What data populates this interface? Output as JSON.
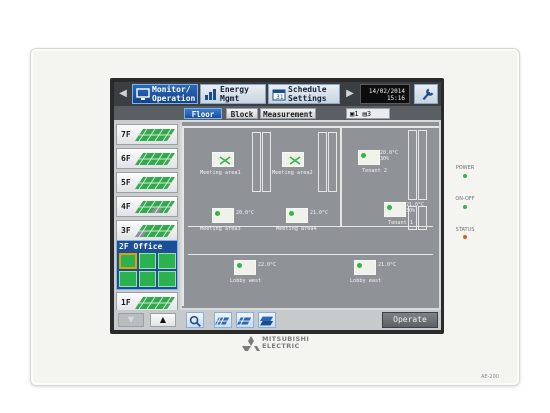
{
  "nav": {
    "tabs": [
      {
        "label": "Monitor/\nOperation",
        "icon": "monitor-icon",
        "active": true
      },
      {
        "label": "Energy\nMgmt",
        "icon": "energy-bars-icon",
        "active": false
      },
      {
        "label": "Schedule\nSettings",
        "icon": "calendar-icon",
        "active": false
      }
    ],
    "datetime": "14/02/2014\n15:16"
  },
  "subtabs": [
    {
      "label": "Floor",
      "active": true
    },
    {
      "label": "Block",
      "active": false
    },
    {
      "label": "Measurement",
      "active": false
    }
  ],
  "counts": {
    "a": "1",
    "b": "3"
  },
  "floors": [
    {
      "label": "7F"
    },
    {
      "label": "6F"
    },
    {
      "label": "5F"
    },
    {
      "label": "4F"
    },
    {
      "label": "3F"
    }
  ],
  "selected_floor": {
    "label": "2F Office"
  },
  "lower_floor": {
    "label": "1F"
  },
  "rooms": [
    {
      "label": "Meeting area1"
    },
    {
      "label": "Meeting area2"
    },
    {
      "label": "Tenant 2",
      "temp": "20.0°C\n30%"
    },
    {
      "label": "Meeting area3",
      "temp": "20.0°C"
    },
    {
      "label": "Meeting area4",
      "temp": "21.0°C"
    },
    {
      "label": "Tenant 1",
      "temp": "21.0°C\n30%"
    },
    {
      "label": "Lobby west",
      "temp": "22.0°C"
    },
    {
      "label": "Lobby east",
      "temp": "21.0°C"
    }
  ],
  "bottom": {
    "operate_label": "Operate",
    "up": "▲",
    "down": "▼"
  },
  "indicators": {
    "power": "POWER",
    "onoff": "ON-OFF",
    "status": "STATUS"
  },
  "brand": {
    "line1": "MITSUBISHI",
    "line2": "ELECTRIC",
    "model": "AE-200"
  },
  "colors": {
    "accent": "#1a4f98",
    "unit_on": "#35b34a",
    "status_led": "#e05a1a"
  }
}
